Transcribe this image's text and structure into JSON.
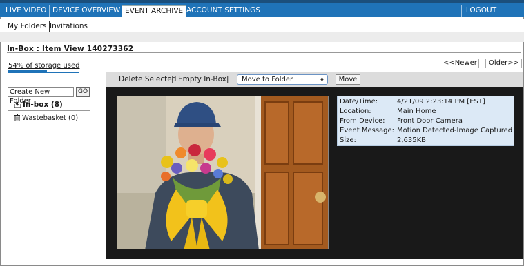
{
  "nav": {
    "tabs": [
      {
        "label": "LIVE VIDEO"
      },
      {
        "label": "DEVICE OVERVIEW"
      },
      {
        "label": "EVENT ARCHIVE",
        "active": true
      },
      {
        "label": "ACCOUNT SETTINGS"
      }
    ],
    "logout_label": "LOGOUT"
  },
  "subnav": {
    "tabs": [
      {
        "label": "My Folders"
      },
      {
        "label": "Invitations"
      }
    ]
  },
  "page_title": "In-Box : Item View 140273362",
  "storage": {
    "label": "54% of storage used",
    "fraction": 0.54
  },
  "pager": {
    "newer_label": "<<Newer",
    "older_label": "Older>>"
  },
  "toolbar": {
    "delete_label": "Delete Selected",
    "separator": "|",
    "empty_label": "Empty In-Box",
    "select_value": "Move to Folder",
    "move_label": "Move"
  },
  "sidebar": {
    "new_folder_value": "Create New Folder",
    "go_label": "GO",
    "folders": [
      {
        "label": "In-box (8)",
        "icon": "inbox-icon"
      },
      {
        "label": "Wastebasket (0)",
        "icon": "trash-icon"
      }
    ]
  },
  "event": {
    "rows": [
      {
        "label": "Date/Time:",
        "value": "4/21/09 2:23:14 PM [EST]"
      },
      {
        "label": "Location:",
        "value": "Main Home"
      },
      {
        "label": "From Device:",
        "value": "Front Door Camera"
      },
      {
        "label": "Event Message:",
        "value": "Motion Detected-Image Captured"
      },
      {
        "label": "Size:",
        "value": "2,635KB"
      }
    ]
  },
  "colors": {
    "nav_blue": "#1f73b8",
    "viewer_bg": "#191919",
    "info_bg": "#dce9f6"
  }
}
